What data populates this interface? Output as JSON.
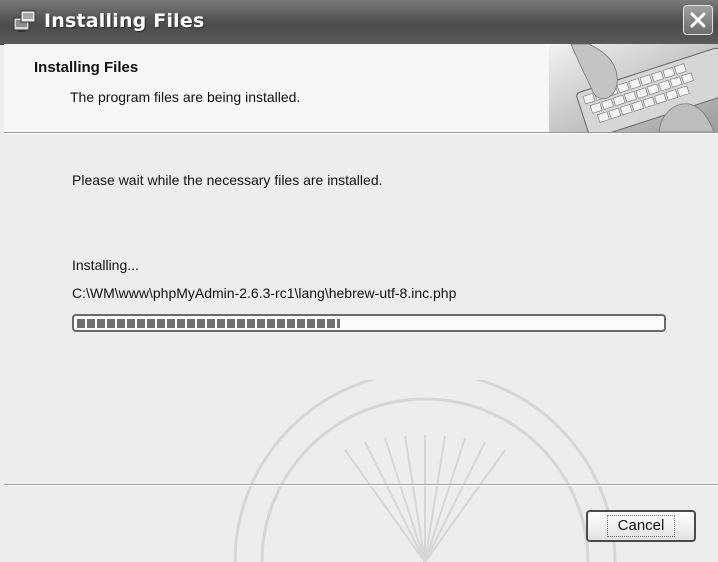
{
  "window": {
    "title": "Installing Files",
    "title_icon": "installer-icon",
    "close_icon": "close-icon"
  },
  "header": {
    "title": "Installing Files",
    "subtitle": "The program files are being installed.",
    "image": "keyboard-photo"
  },
  "body": {
    "message": "Please wait while the necessary files are installed.",
    "status_label": "Installing...",
    "current_file": "C:\\WM\\www\\phpMyAdmin-2.6.3-rc1\\lang\\hebrew-utf-8.inc.php",
    "progress_fraction": 0.45
  },
  "footer": {
    "cancel_label": "Cancel"
  },
  "colors": {
    "titlebar": "#5b5b5b",
    "panel": "#ededed",
    "progress_fill": "#6f6f6f"
  }
}
